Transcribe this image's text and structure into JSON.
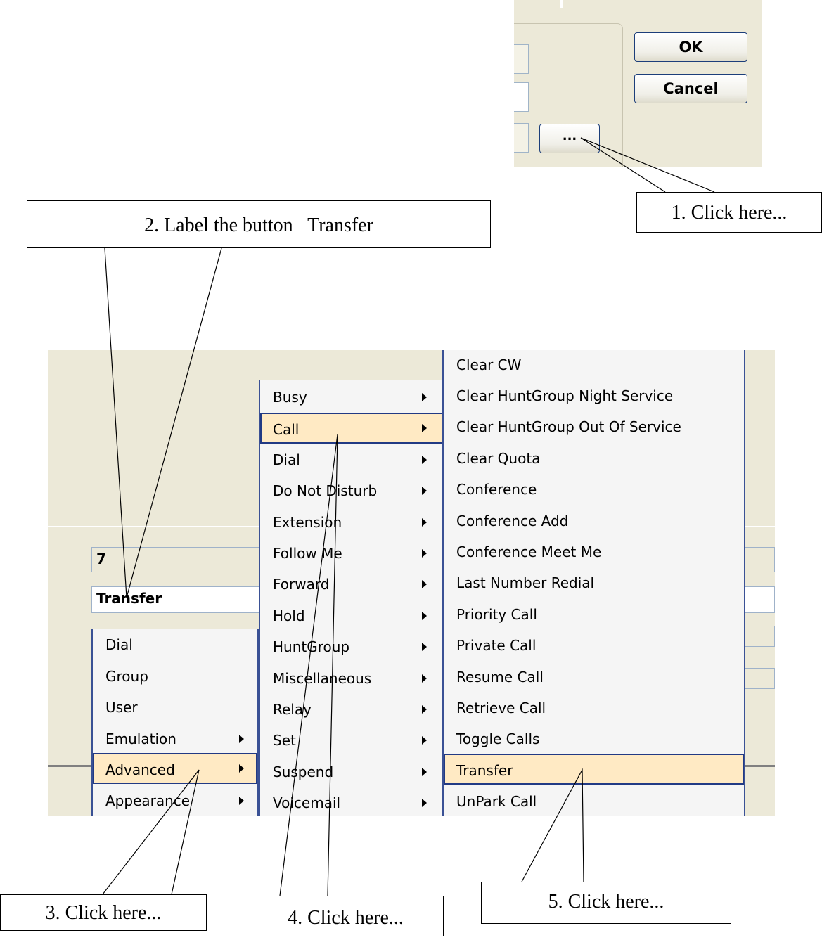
{
  "dialog": {
    "ok_label": "OK",
    "cancel_label": "Cancel",
    "browse_label": "..."
  },
  "fields": {
    "number_value": "7",
    "label_value": "Transfer"
  },
  "menu_level1": [
    {
      "label": "Dial",
      "submenu": false
    },
    {
      "label": "Group",
      "submenu": false
    },
    {
      "label": "User",
      "submenu": false
    },
    {
      "label": "Emulation",
      "submenu": true
    },
    {
      "label": "Advanced",
      "submenu": true,
      "highlighted": true
    },
    {
      "label": "Appearance",
      "submenu": true
    }
  ],
  "menu_level2": [
    {
      "label": "Busy"
    },
    {
      "label": "Call",
      "highlighted": true
    },
    {
      "label": "Dial"
    },
    {
      "label": "Do Not Disturb"
    },
    {
      "label": "Extension"
    },
    {
      "label": "Follow Me"
    },
    {
      "label": "Forward"
    },
    {
      "label": "Hold"
    },
    {
      "label": "HuntGroup"
    },
    {
      "label": "Miscellaneous"
    },
    {
      "label": "Relay"
    },
    {
      "label": "Set"
    },
    {
      "label": "Suspend"
    },
    {
      "label": "Voicemail"
    }
  ],
  "menu_level3": [
    {
      "label": "Clear CW"
    },
    {
      "label": "Clear HuntGroup Night Service"
    },
    {
      "label": "Clear HuntGroup Out Of Service"
    },
    {
      "label": "Clear Quota"
    },
    {
      "label": "Conference"
    },
    {
      "label": "Conference Add"
    },
    {
      "label": "Conference Meet Me"
    },
    {
      "label": "Last Number Redial"
    },
    {
      "label": "Priority Call"
    },
    {
      "label": "Private Call"
    },
    {
      "label": "Resume Call"
    },
    {
      "label": "Retrieve Call"
    },
    {
      "label": "Toggle Calls"
    },
    {
      "label": "Transfer",
      "highlighted": true
    },
    {
      "label": "UnPark Call"
    }
  ],
  "callouts": {
    "step1": "1. Click here...",
    "step2": "2. Label the button   Transfer",
    "step3": "3. Click here...",
    "step4": "4. Click here...",
    "step5": "5. Click here..."
  }
}
